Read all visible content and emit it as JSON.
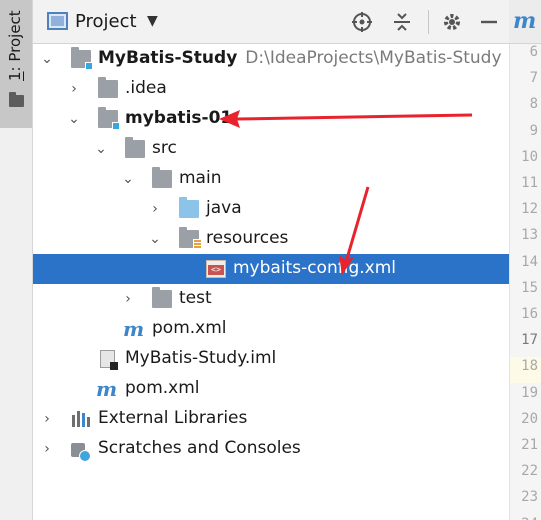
{
  "tool_strip": {
    "tab_label_underline": "1",
    "tab_label_rest": ": Project"
  },
  "header": {
    "title": "Project",
    "caret": "▼",
    "icons": [
      "project-view-icon",
      "target-icon",
      "collapse-icon",
      "gear-icon",
      "minimize-icon"
    ]
  },
  "editor": {
    "tab_glyph": "m",
    "line_numbers": [
      "6",
      "7",
      "8",
      "9",
      "10",
      "11",
      "12",
      "13",
      "14",
      "15",
      "16",
      "17",
      "18",
      "19",
      "20",
      "21",
      "22",
      "23",
      "24"
    ],
    "current_line": "17"
  },
  "tree": {
    "root": {
      "name": "MyBatis-Study",
      "path": "D:\\IdeaProjects\\MyBatis-Study"
    },
    "idea": ".idea",
    "module": "mybatis-01",
    "src": "src",
    "main": "main",
    "java": "java",
    "resources": "resources",
    "config_file": "mybaits-config.xml",
    "test": "test",
    "module_pom": "pom.xml",
    "iml": "MyBatis-Study.iml",
    "root_pom": "pom.xml",
    "external_libraries": "External Libraries",
    "scratches": "Scratches and Consoles"
  },
  "colors": {
    "selection": "#2b73c8",
    "annotation": "#e8232d",
    "maven": "#3e86c9"
  }
}
